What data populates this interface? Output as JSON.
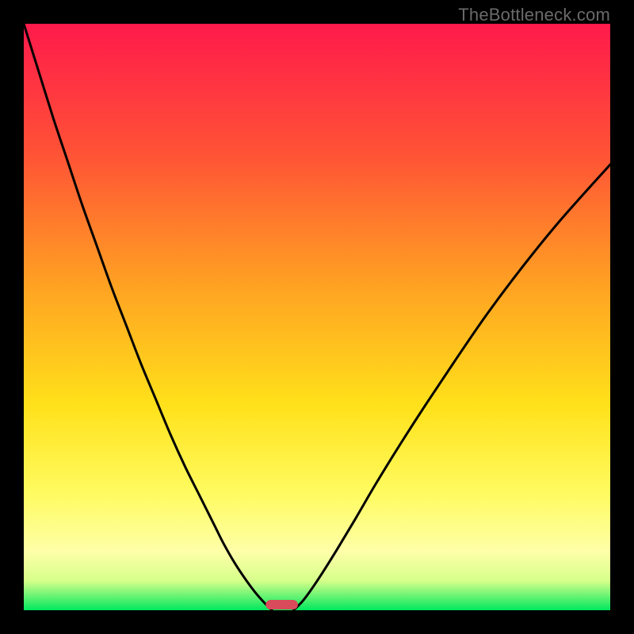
{
  "watermark": {
    "text": "TheBottleneck.com"
  },
  "chart_data": {
    "type": "line",
    "title": "",
    "xlabel": "",
    "ylabel": "",
    "xlim": [
      0,
      100
    ],
    "ylim": [
      0,
      100
    ],
    "background_gradient": {
      "stops": [
        {
          "offset": 0.0,
          "color": "#ff1a4b"
        },
        {
          "offset": 0.22,
          "color": "#ff5236"
        },
        {
          "offset": 0.45,
          "color": "#ffa322"
        },
        {
          "offset": 0.65,
          "color": "#ffe11a"
        },
        {
          "offset": 0.8,
          "color": "#fffb60"
        },
        {
          "offset": 0.9,
          "color": "#feffa8"
        },
        {
          "offset": 0.95,
          "color": "#d6ff8a"
        },
        {
          "offset": 1.0,
          "color": "#00e85e"
        }
      ]
    },
    "series": [
      {
        "name": "left-branch",
        "x": [
          0.0,
          2.5,
          5.0,
          7.5,
          10.0,
          12.5,
          15.0,
          17.5,
          20.0,
          22.5,
          25.0,
          27.5,
          30.0,
          32.5,
          34.0,
          36.0,
          38.0,
          39.5,
          41.0,
          42.3
        ],
        "y": [
          100.0,
          92.0,
          84.0,
          76.5,
          69.0,
          62.0,
          55.0,
          48.5,
          42.0,
          36.0,
          30.0,
          24.5,
          19.5,
          14.5,
          11.5,
          8.0,
          5.0,
          3.0,
          1.3,
          0.0
        ]
      },
      {
        "name": "right-branch",
        "x": [
          46.0,
          47.5,
          49.0,
          51.0,
          53.5,
          56.5,
          60.0,
          64.0,
          68.5,
          73.5,
          79.0,
          85.0,
          91.5,
          100.0
        ],
        "y": [
          0.0,
          1.5,
          3.5,
          6.5,
          10.5,
          15.5,
          21.5,
          28.0,
          35.0,
          42.5,
          50.5,
          58.5,
          66.5,
          76.0
        ]
      }
    ],
    "marker": {
      "name": "optimum-marker",
      "x_center": 44.0,
      "width": 5.5,
      "color": "#d94a5a"
    }
  }
}
